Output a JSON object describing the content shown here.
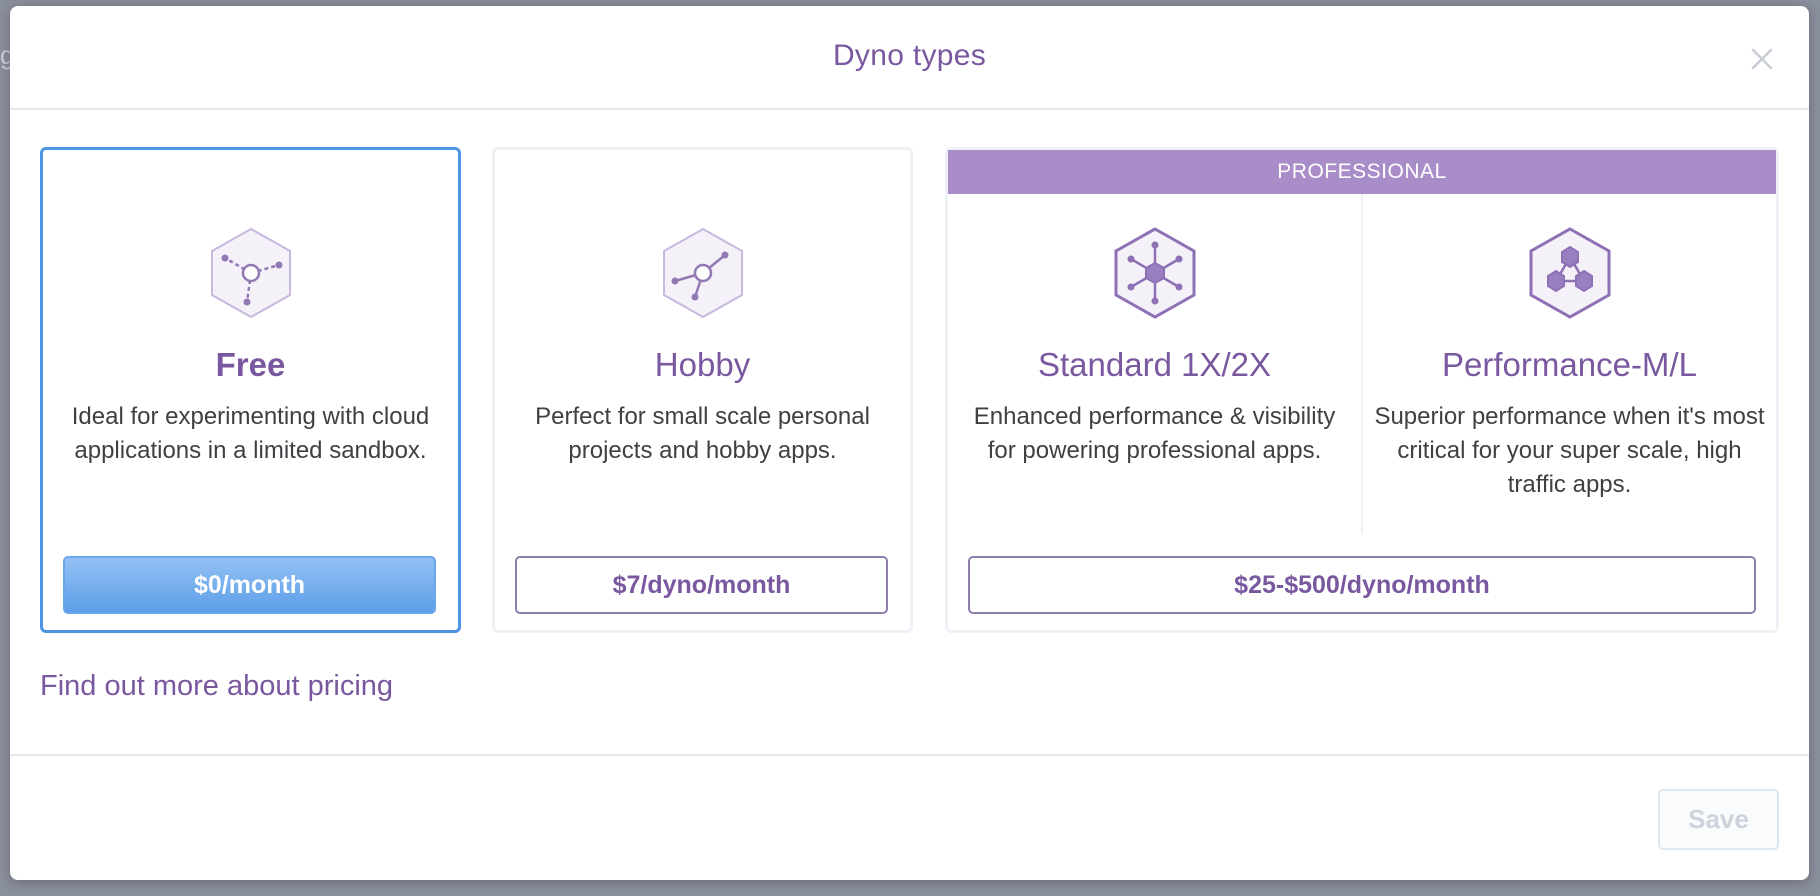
{
  "modal": {
    "title": "Dyno types",
    "close_icon": "close-icon"
  },
  "tiers": {
    "free": {
      "name": "Free",
      "description": "Ideal for experimenting with cloud applications in a limited sandbox.",
      "price": "$0/month",
      "icon": "free-dyno-icon",
      "selected": true
    },
    "hobby": {
      "name": "Hobby",
      "description": "Perfect for small scale personal projects and hobby apps.",
      "price": "$7/dyno/month",
      "icon": "hobby-dyno-icon"
    },
    "professional": {
      "banner": "PROFESSIONAL",
      "price": "$25-$500/dyno/month",
      "standard": {
        "name": "Standard 1X/2X",
        "description": "Enhanced performance & visibility for powering professional apps.",
        "icon": "standard-dyno-icon"
      },
      "performance": {
        "name": "Performance-M/L",
        "description": "Superior performance when it's most critical for your super scale, high traffic apps.",
        "icon": "performance-dyno-icon"
      }
    }
  },
  "footer": {
    "pricing_link": "Find out more about pricing",
    "save_label": "Save"
  },
  "colors": {
    "brand_purple": "#79589f",
    "selected_blue": "#4d95e2",
    "professional_banner": "#a98dc8"
  }
}
